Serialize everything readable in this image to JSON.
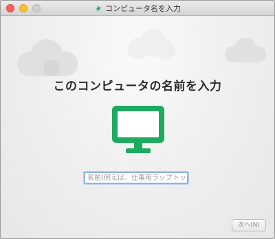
{
  "window": {
    "title": "コンピュータ名を入力"
  },
  "main": {
    "heading": "このコンピュータの名前を入力",
    "icon": "desktop-monitor-icon",
    "accent_color": "#1dab5f"
  },
  "name_field": {
    "value": "",
    "placeholder": "名前(例えば、仕事用ラップトップ)"
  },
  "footer": {
    "next_label": "次へ(N)",
    "next_enabled": false
  }
}
